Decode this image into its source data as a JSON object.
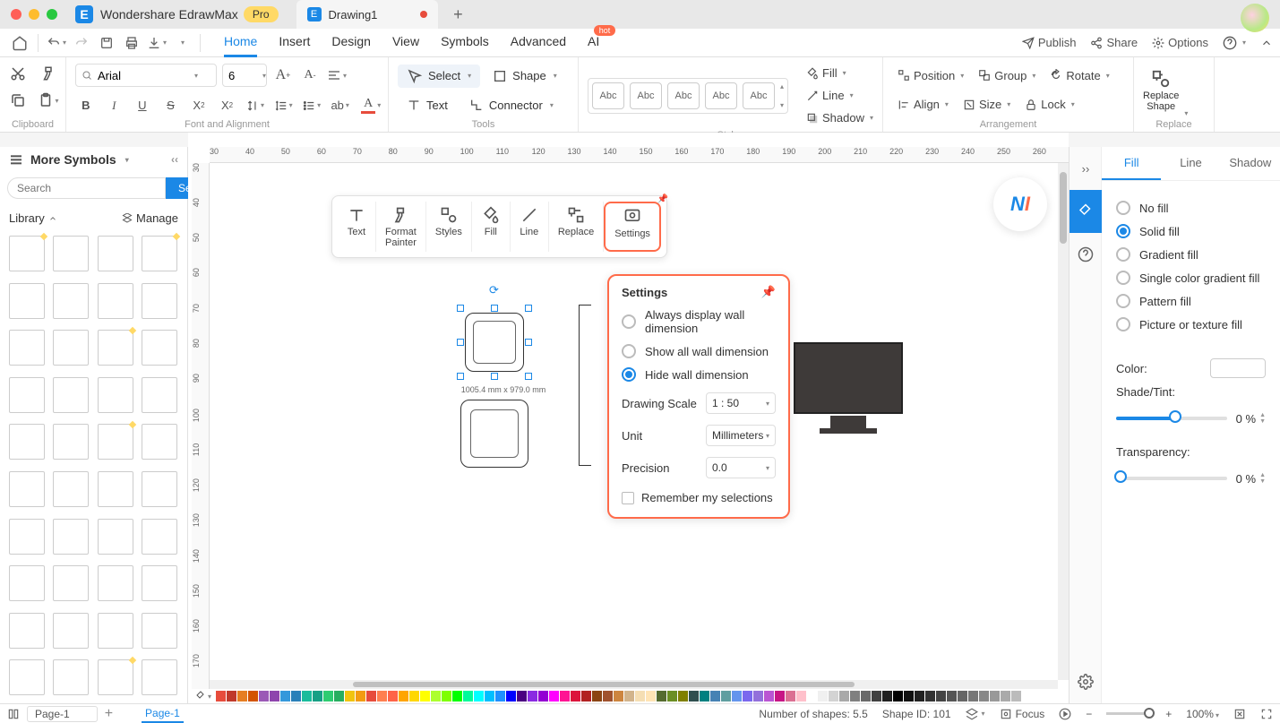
{
  "app": {
    "name": "Wondershare EdrawMax",
    "badge": "Pro",
    "doc_name": "Drawing1"
  },
  "menubar": {
    "tabs": [
      "Home",
      "Insert",
      "Design",
      "View",
      "Symbols",
      "Advanced",
      "AI"
    ],
    "hot": "hot",
    "right": {
      "publish": "Publish",
      "share": "Share",
      "options": "Options"
    }
  },
  "ribbon": {
    "clipboard_label": "Clipboard",
    "font_label": "Font and Alignment",
    "font_family": "Arial",
    "font_size": "6",
    "tools_label": "Tools",
    "select": "Select",
    "shape": "Shape",
    "text": "Text",
    "connector": "Connector",
    "styles_label": "Styles",
    "style_swatch": "Abc",
    "fill": "Fill",
    "line": "Line",
    "shadow": "Shadow",
    "arrangement_label": "Arrangement",
    "position": "Position",
    "group": "Group",
    "rotate": "Rotate",
    "align": "Align",
    "size": "Size",
    "lock": "Lock",
    "replace_label": "Replace",
    "replace_shape": "Replace\nShape"
  },
  "left_panel": {
    "header": "More Symbols",
    "search_placeholder": "Search",
    "search_btn": "Search",
    "library": "Library",
    "manage": "Manage"
  },
  "ruler_h": [
    "30",
    "40",
    "50",
    "60",
    "70",
    "80",
    "90",
    "100",
    "110",
    "120",
    "130",
    "140",
    "150",
    "160",
    "170",
    "180",
    "190",
    "200",
    "210",
    "220",
    "230",
    "240",
    "250",
    "260"
  ],
  "ruler_v": [
    "30",
    "40",
    "50",
    "60",
    "70",
    "80",
    "90",
    "100",
    "110",
    "120",
    "130",
    "140",
    "150",
    "160",
    "170"
  ],
  "float_toolbar": {
    "text": "Text",
    "format_painter": "Format\nPainter",
    "styles": "Styles",
    "fill": "Fill",
    "line": "Line",
    "replace": "Replace",
    "settings": "Settings"
  },
  "canvas": {
    "dims": "1005.4 mm x 979.0 mm"
  },
  "settings_popup": {
    "title": "Settings",
    "opt_always": "Always display wall dimension",
    "opt_show_all": "Show all wall dimension",
    "opt_hide": "Hide wall dimension",
    "drawing_scale": "Drawing Scale",
    "drawing_scale_val": "1 : 50",
    "unit": "Unit",
    "unit_val": "Millimeters",
    "precision": "Precision",
    "precision_val": "0.0",
    "remember": "Remember my selections"
  },
  "right_panel": {
    "tabs": {
      "fill": "Fill",
      "line": "Line",
      "shadow": "Shadow"
    },
    "no_fill": "No fill",
    "solid_fill": "Solid fill",
    "gradient_fill": "Gradient fill",
    "single_gradient": "Single color gradient fill",
    "pattern_fill": "Pattern fill",
    "picture_fill": "Picture or texture fill",
    "color": "Color:",
    "shade": "Shade/Tint:",
    "transparency": "Transparency:",
    "shade_val": "0 %",
    "transparency_val": "0 %"
  },
  "statusbar": {
    "page_select": "Page-1",
    "page_tab": "Page-1",
    "num_shapes": "Number of shapes: 5.5",
    "shape_id": "Shape ID: 101",
    "focus": "Focus",
    "zoom": "100%"
  },
  "color_chips": [
    "#e74c3c",
    "#c0392b",
    "#e67e22",
    "#d35400",
    "#9b59b6",
    "#8e44ad",
    "#3498db",
    "#2980b9",
    "#1abc9c",
    "#16a085",
    "#2ecc71",
    "#27ae60",
    "#f1c40f",
    "#f39c12",
    "#e74c3c",
    "#ff7f50",
    "#ff6347",
    "#ffa500",
    "#ffd700",
    "#ffff00",
    "#adff2f",
    "#7fff00",
    "#00ff00",
    "#00fa9a",
    "#00ffff",
    "#00bfff",
    "#1e90ff",
    "#0000ff",
    "#4b0082",
    "#8a2be2",
    "#9400d3",
    "#ff00ff",
    "#ff1493",
    "#dc143c",
    "#b22222",
    "#8b4513",
    "#a0522d",
    "#cd853f",
    "#d2b48c",
    "#f5deb3",
    "#ffe4b5",
    "#556b2f",
    "#6b8e23",
    "#808000",
    "#2f4f4f",
    "#008080",
    "#4682b4",
    "#5f9ea0",
    "#6495ed",
    "#7b68ee",
    "#9370db",
    "#ba55d3",
    "#c71585",
    "#db7093",
    "#ffc0cb",
    "#ffffff",
    "#f0f0f0",
    "#d3d3d3",
    "#a9a9a9",
    "#808080",
    "#696969",
    "#404040",
    "#202020",
    "#000000",
    "#111",
    "#222",
    "#333",
    "#444",
    "#555",
    "#666",
    "#777",
    "#888",
    "#999",
    "#aaa",
    "#bbb"
  ]
}
